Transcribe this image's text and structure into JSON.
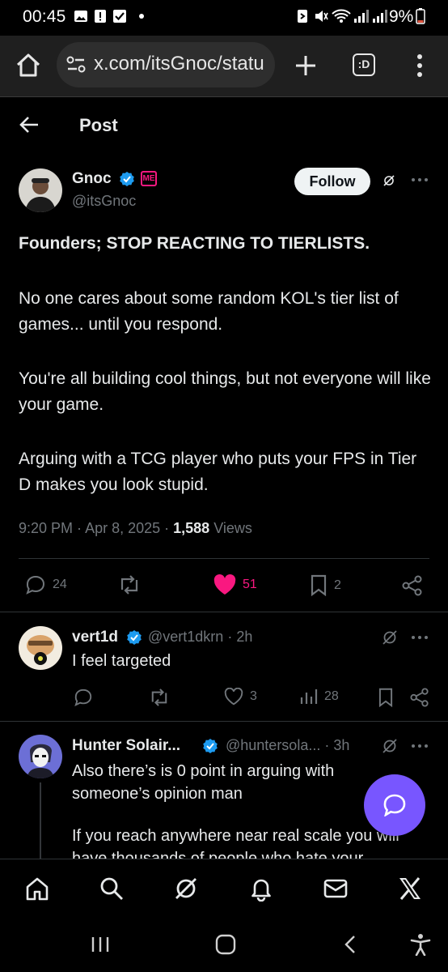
{
  "status_bar": {
    "time": "00:45",
    "battery": "9%"
  },
  "browser": {
    "url": "x.com/itsGnoc/statu",
    "tab_count": ":D"
  },
  "header": {
    "title": "Post"
  },
  "post": {
    "author_name": "Gnoc",
    "author_handle": "@itsGnoc",
    "follow_label": "Follow",
    "headline": "Founders; STOP REACTING TO TIERLISTS.",
    "paragraphs": [
      "No one cares about some random KOL's tier list of games... until you respond.",
      "You're all building cool things, but not everyone will like your game.",
      "Arguing with a TCG player who puts your FPS in Tier D makes you look stupid."
    ],
    "time": "9:20 PM",
    "date": "Apr 8, 2025",
    "views_count": "1,588",
    "views_label": "Views",
    "replies": "24",
    "likes": "51",
    "bookmarks": "2"
  },
  "replies": [
    {
      "name": "vert1d",
      "handle": "@vert1dkrn",
      "age": "2h",
      "text": "I feel targeted",
      "likes": "3",
      "views": "28"
    },
    {
      "name": "Hunter Solair...",
      "handle": "@huntersola...",
      "age": "3h",
      "lines": [
        "Also there’s is 0 point in arguing with someone’s opinion man",
        "If you reach anywhere near real scale you will have thousands of people who hate your"
      ]
    }
  ],
  "colors": {
    "accent": "#1d9bf0",
    "like": "#f91880",
    "fab": "#7856ff"
  }
}
